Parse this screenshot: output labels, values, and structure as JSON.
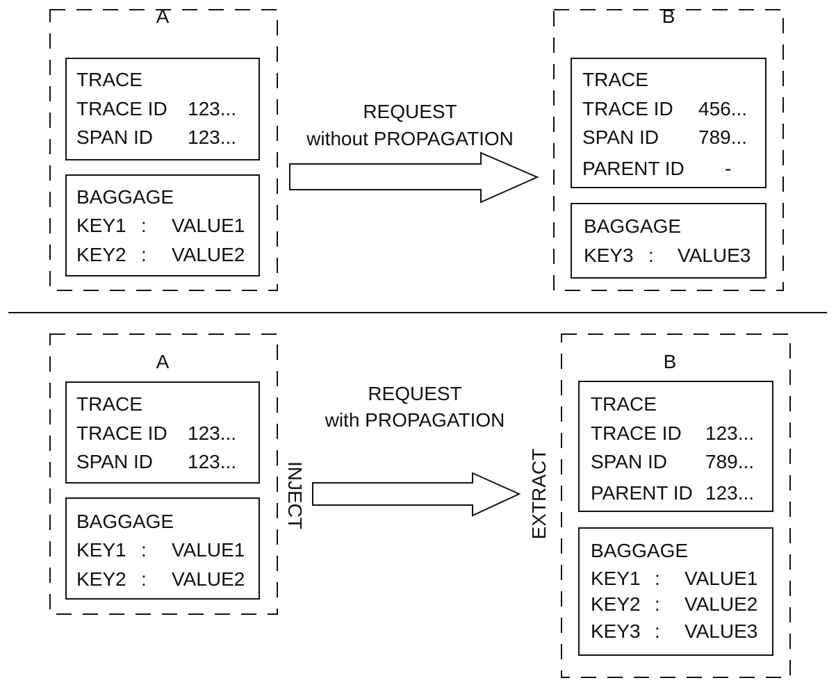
{
  "top": {
    "service_a": {
      "label": "A",
      "trace": {
        "title": "TRACE",
        "trace_id_label": "TRACE ID",
        "trace_id": "123...",
        "span_id_label": "SPAN ID",
        "span_id": "123..."
      },
      "baggage": {
        "title": "BAGGAGE",
        "items": [
          {
            "key": "KEY1",
            "sep": ":",
            "value": "VALUE1"
          },
          {
            "key": "KEY2",
            "sep": ":",
            "value": "VALUE2"
          }
        ]
      }
    },
    "arrow": {
      "line1": "REQUEST",
      "line2": "without PROPAGATION"
    },
    "service_b": {
      "label": "B",
      "trace": {
        "title": "TRACE",
        "trace_id_label": "TRACE ID",
        "trace_id": "456...",
        "span_id_label": "SPAN ID",
        "span_id": "789...",
        "parent_id_label": "PARENT ID",
        "parent_id": "-"
      },
      "baggage": {
        "title": "BAGGAGE",
        "items": [
          {
            "key": "KEY3",
            "sep": ":",
            "value": "VALUE3"
          }
        ]
      }
    }
  },
  "bottom": {
    "service_a": {
      "label": "A",
      "trace": {
        "title": "TRACE",
        "trace_id_label": "TRACE ID",
        "trace_id": "123...",
        "span_id_label": "SPAN ID",
        "span_id": "123..."
      },
      "baggage": {
        "title": "BAGGAGE",
        "items": [
          {
            "key": "KEY1",
            "sep": ":",
            "value": "VALUE1"
          },
          {
            "key": "KEY2",
            "sep": ":",
            "value": "VALUE2"
          }
        ]
      }
    },
    "arrow": {
      "line1": "REQUEST",
      "line2": "with PROPAGATION",
      "inject": "INJECT",
      "extract": "EXTRACT"
    },
    "service_b": {
      "label": "B",
      "trace": {
        "title": "TRACE",
        "trace_id_label": "TRACE ID",
        "trace_id": "123...",
        "span_id_label": "SPAN ID",
        "span_id": "789...",
        "parent_id_label": "PARENT ID",
        "parent_id": "123..."
      },
      "baggage": {
        "title": "BAGGAGE",
        "items": [
          {
            "key": "KEY1",
            "sep": ":",
            "value": "VALUE1"
          },
          {
            "key": "KEY2",
            "sep": ":",
            "value": "VALUE2"
          },
          {
            "key": "KEY3",
            "sep": ":",
            "value": "VALUE3"
          }
        ]
      }
    }
  }
}
